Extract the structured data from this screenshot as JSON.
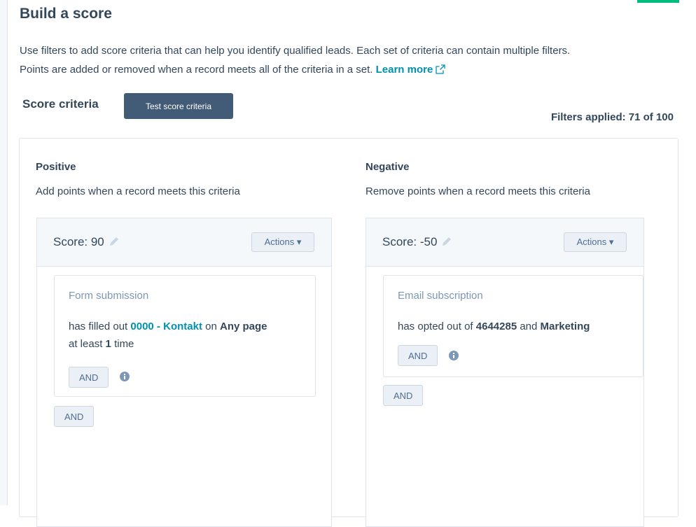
{
  "header": {
    "title": "Build a score",
    "description_line1": "Use filters to add score criteria that can help you identify qualified leads. Each set of criteria can contain multiple filters.",
    "description_line2": "Points are added or removed when a record meets all of the criteria in a set.",
    "learn_more": "Learn more"
  },
  "score_criteria": {
    "title": "Score criteria",
    "test_button": "Test score criteria",
    "filters_applied": "Filters applied: 71 of 100"
  },
  "positive": {
    "title": "Positive",
    "subtitle": "Add points when a record meets this criteria",
    "score": "Score: 90",
    "actions": "Actions ▾",
    "filter": {
      "type": "Form submission",
      "text1": "has filled out",
      "form": "0000 - Kontakt",
      "text2": "on",
      "page": "Any page",
      "text3": "at least",
      "count": "1",
      "text4": "time",
      "and_inner": "AND"
    },
    "and_outer": "AND"
  },
  "negative": {
    "title": "Negative",
    "subtitle": "Remove points when a record meets this criteria",
    "score": "Score: -50",
    "actions": "Actions ▾",
    "filter": {
      "type": "Email subscription",
      "text1": "has opted out of",
      "value1": "4644285",
      "text2": "and",
      "value2": "Marketing",
      "and_inner": "AND"
    },
    "and_outer": "AND"
  },
  "icons": {
    "external_link": "external-link-icon",
    "pencil": "pencil-icon",
    "info": "info-icon"
  },
  "colors": {
    "primary_text": "#33475b",
    "link": "#0091ae",
    "button_dark": "#425b76",
    "muted": "#7c98b6",
    "panel_bg": "#f5f8fa"
  }
}
